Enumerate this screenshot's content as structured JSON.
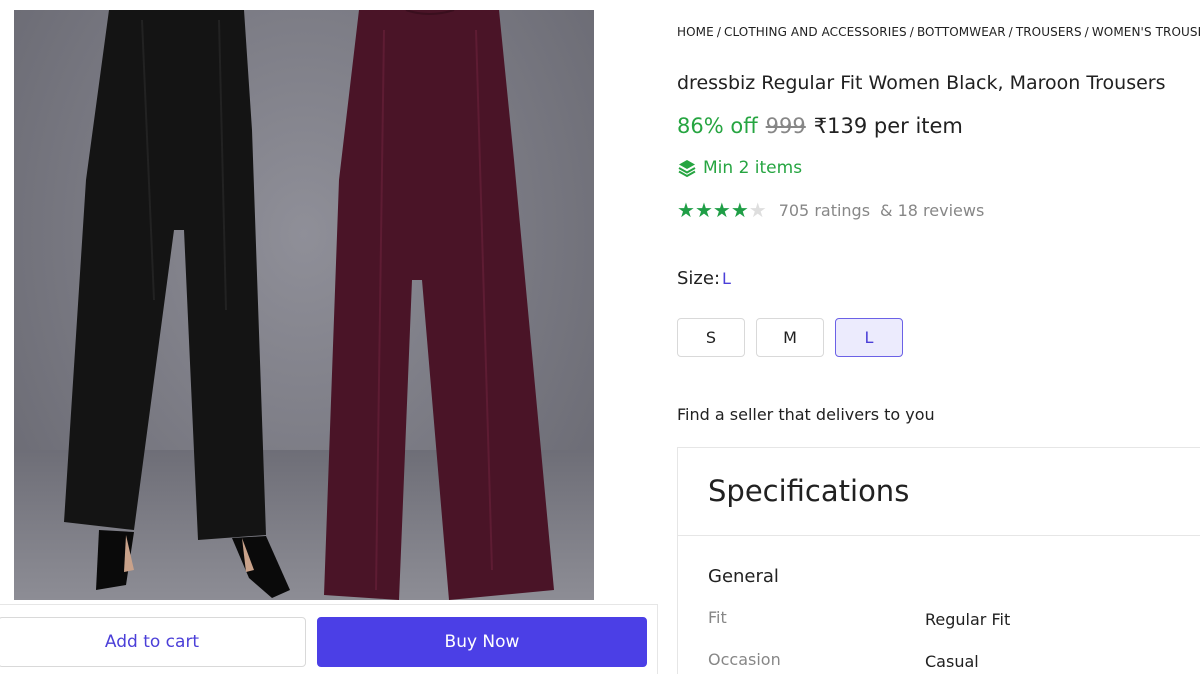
{
  "breadcrumb": [
    "HOME",
    "CLOTHING AND ACCESSORIES",
    "BOTTOMWEAR",
    "TROUSERS",
    "WOMEN'S TROUSERS"
  ],
  "product": {
    "title": "dressbiz Regular Fit Women Black, Maroon Trousers",
    "discount": "86% off",
    "mrp": "999",
    "price": "₹139 per item",
    "min_items": "Min 2 items",
    "rating_stars": 4,
    "ratings_text": "705 ratings",
    "reviews_text": "& 18 reviews"
  },
  "size": {
    "label": "Size:",
    "selected": "L",
    "options": [
      "S",
      "M",
      "L"
    ]
  },
  "seller": {
    "label": "Find a seller that delivers to you"
  },
  "specs": {
    "title": "Specifications",
    "group": "General",
    "rows": [
      {
        "key": "Fit",
        "value": "Regular Fit"
      },
      {
        "key": "Occasion",
        "value": "Casual"
      }
    ]
  },
  "actions": {
    "add_to_cart": "Add to cart",
    "buy_now": "Buy Now"
  },
  "colors": {
    "green": "#26a541",
    "primary": "#4b3fe6",
    "trouser_black": "#141414",
    "trouser_maroon": "#4a1427"
  }
}
